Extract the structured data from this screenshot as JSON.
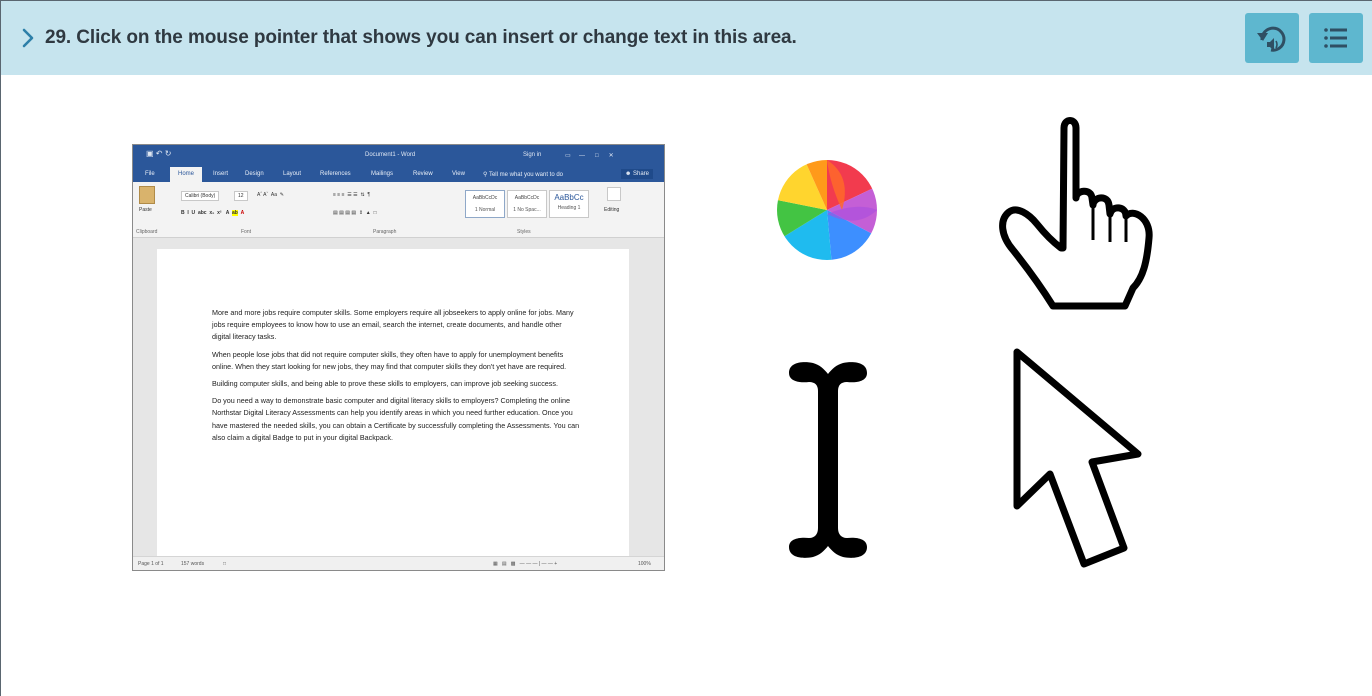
{
  "question": {
    "text": "29. Click on the mouse pointer that shows you can insert or change text in this area.",
    "chevron_icon": "chevron-right-icon",
    "replay_audio_icon": "replay-audio-icon",
    "menu_icon": "list-menu-icon"
  },
  "word_screenshot": {
    "title": "Document1 - Word",
    "sign_in": "Sign in",
    "tabs": [
      "File",
      "Home",
      "Insert",
      "Design",
      "Layout",
      "References",
      "Mailings",
      "Review",
      "View"
    ],
    "tell_me": "Tell me what you want to do",
    "share": "Share",
    "font_name": "Calibri (Body)",
    "font_size": "12",
    "paste": "Paste",
    "groups": [
      "Clipboard",
      "Font",
      "Paragraph",
      "Styles",
      "Editing"
    ],
    "styles": [
      {
        "preview": "AaBbCcDc",
        "name": "1 Normal"
      },
      {
        "preview": "AaBbCcDc",
        "name": "1 No Spac..."
      },
      {
        "preview": "AaBbCc",
        "name": "Heading 1"
      }
    ],
    "paragraphs": [
      "More and more jobs require computer skills. Some employers require all jobseekers to apply online for jobs. Many jobs require employees to know how to use an email, search the internet, create documents, and handle other digital literacy tasks.",
      "When people lose jobs that did not require computer skills, they often have to apply for unemployment benefits online. When they start looking for new jobs, they may find that computer skills they don't yet have are required.",
      "Building computer skills, and being able to prove these skills to employers, can improve job seeking success.",
      "Do you need a way to demonstrate basic computer and digital literacy skills to employers? Completing the online Northstar Digital Literacy Assessments can help you identify areas in which you need further education. Once you have mastered the needed skills, you can obtain a Certificate by successfully completing the Assessments. You can also claim a digital Badge to put in your digital Backpack."
    ],
    "status_page": "Page 1 of 1",
    "status_words": "157 words",
    "zoom": "100%"
  },
  "options": [
    {
      "name": "spinning-wheel-pointer",
      "icon": "spinning-wheel-icon"
    },
    {
      "name": "hand-pointer",
      "icon": "hand-pointer-icon"
    },
    {
      "name": "i-beam-pointer",
      "icon": "i-beam-text-cursor-icon"
    },
    {
      "name": "arrow-pointer",
      "icon": "arrow-cursor-icon"
    }
  ],
  "colors": {
    "question_bar": "#c6e4ee",
    "button": "#5eb7cf",
    "word_blue": "#2b579a"
  }
}
